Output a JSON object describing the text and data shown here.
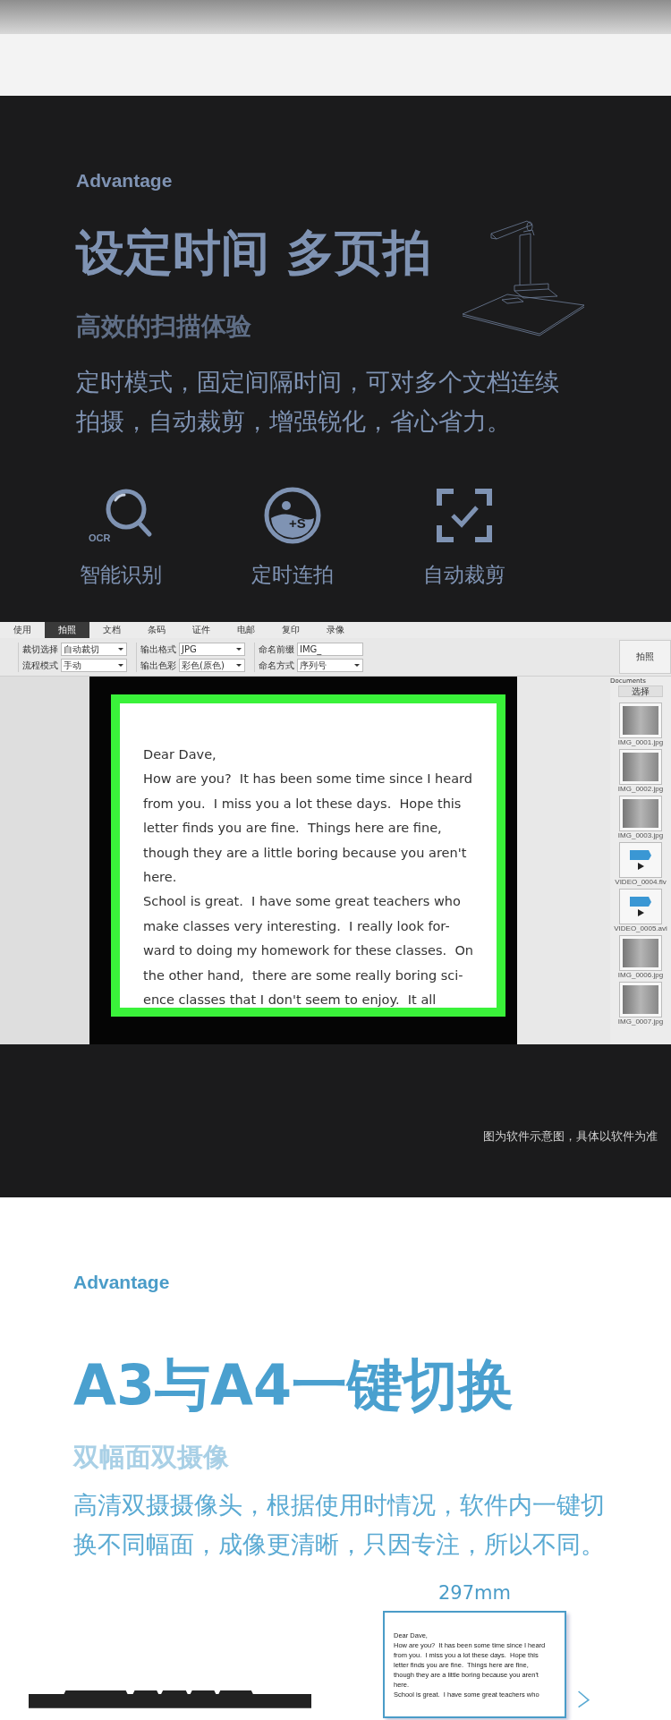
{
  "feature_section": {
    "eyebrow": "Advantage",
    "title": "设定时间 多页拍",
    "subtitle": "高效的扫描体验",
    "description": "定时模式，固定间隔时间，可对多个文档连续拍摄，自动裁剪，增强锐化，省心省力。",
    "features": [
      {
        "kind": "ocr",
        "badge": "OCR",
        "label": "智能识别"
      },
      {
        "kind": "timer",
        "badge": "+S",
        "label": "定时连拍"
      },
      {
        "kind": "crop",
        "label": "自动裁剪"
      }
    ],
    "software": {
      "tabs": [
        {
          "label": "使用",
          "selected": false
        },
        {
          "label": "拍照",
          "selected": true
        },
        {
          "label": "文档",
          "selected": false
        },
        {
          "label": "条码",
          "selected": false
        },
        {
          "label": "证件",
          "selected": false
        },
        {
          "label": "电邮",
          "selected": false
        },
        {
          "label": "复印",
          "selected": false
        },
        {
          "label": "录像",
          "selected": false
        }
      ],
      "settings": [
        [
          {
            "label": "裁切选择",
            "value": "自动裁切",
            "kind": "select"
          },
          {
            "label": "流程模式",
            "value": "手动",
            "kind": "select"
          }
        ],
        [
          {
            "label": "输出格式",
            "value": "JPG",
            "kind": "select"
          },
          {
            "label": "输出色彩",
            "value": "彩色(原色)",
            "kind": "select"
          }
        ],
        [
          {
            "label": "命名前缀",
            "value": "IMG_",
            "kind": "input"
          },
          {
            "label": "命名方式",
            "value": "序列号",
            "kind": "select"
          }
        ]
      ],
      "capture_button": "拍照",
      "letter_lines": [
        "Dear Dave,",
        "How are you?  It has been some time since I heard",
        "from you.  I miss you a lot these days.  Hope this",
        "letter finds you are fine.  Things here are fine,",
        "though they are a little boring because you aren't",
        "here.",
        "School is great.  I have some great teachers who",
        "make classes very interesting.  I really look for-",
        "ward to doing my homework for these classes.  On",
        "the other hand,  there are some really boring sci-",
        "ence classes that I don't seem to enjoy.  It all"
      ],
      "documents": {
        "title": "Documents",
        "button": "选择",
        "files": [
          {
            "kind": "image",
            "name": "IMG_0001.jpg"
          },
          {
            "kind": "image",
            "name": "IMG_0002.jpg"
          },
          {
            "kind": "image",
            "name": "IMG_0003.jpg"
          },
          {
            "kind": "video",
            "name": "VIDEO_0004.flv"
          },
          {
            "kind": "video",
            "name": "VIDEO_0005.avi"
          },
          {
            "kind": "image",
            "name": "IMG_0006.jpg"
          },
          {
            "kind": "image",
            "name": "IMG_0007.jpg"
          }
        ]
      }
    },
    "caption": "图为软件示意图，具体以软件为准"
  },
  "switch_section": {
    "eyebrow": "Advantage",
    "title": "A3与A4一键切换",
    "subtitle": "双幅面双摄像",
    "description": "高清双摄摄像头，根据使用时情况，软件内一键切换不同幅面，成像更清晰，只因专注，所以不同。",
    "dimension_label": "297mm",
    "document_lines": [
      "Dear Dave,",
      "How are you?  It has been some time since I heard",
      "from you.  I miss you a lot these days.  Hope this",
      "letter finds you are fine.  Things here are fine,",
      "though they are a little boring because you aren't",
      "here.",
      "School is great.  I have some great teachers who"
    ]
  }
}
